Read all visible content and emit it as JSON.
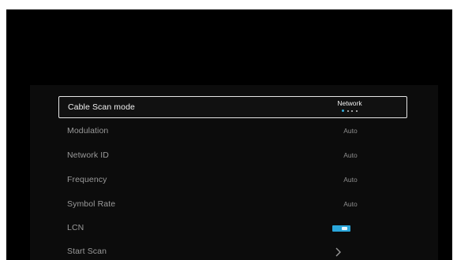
{
  "menu": {
    "items": [
      {
        "label": "Cable Scan mode",
        "value": "Network",
        "type": "option",
        "option_count": 4,
        "selected_option_index": 0,
        "focused": true
      },
      {
        "label": "Modulation",
        "value": "Auto",
        "type": "option"
      },
      {
        "label": "Network ID",
        "value": "Auto",
        "type": "option"
      },
      {
        "label": "Frequency",
        "value": "Auto",
        "type": "option"
      },
      {
        "label": "Symbol Rate",
        "value": "Auto",
        "type": "option"
      },
      {
        "label": "LCN",
        "type": "toggle",
        "on": true
      },
      {
        "label": "Start Scan",
        "type": "action",
        "icon": "chevron-right-icon"
      }
    ]
  },
  "colors": {
    "screen_background": "#000000",
    "panel_background": "#0c0c0c",
    "focus_border": "#e6e6e6",
    "accent": "#2aa6da",
    "label_text": "#9a9a9a",
    "focused_text": "#f2f2f2"
  }
}
